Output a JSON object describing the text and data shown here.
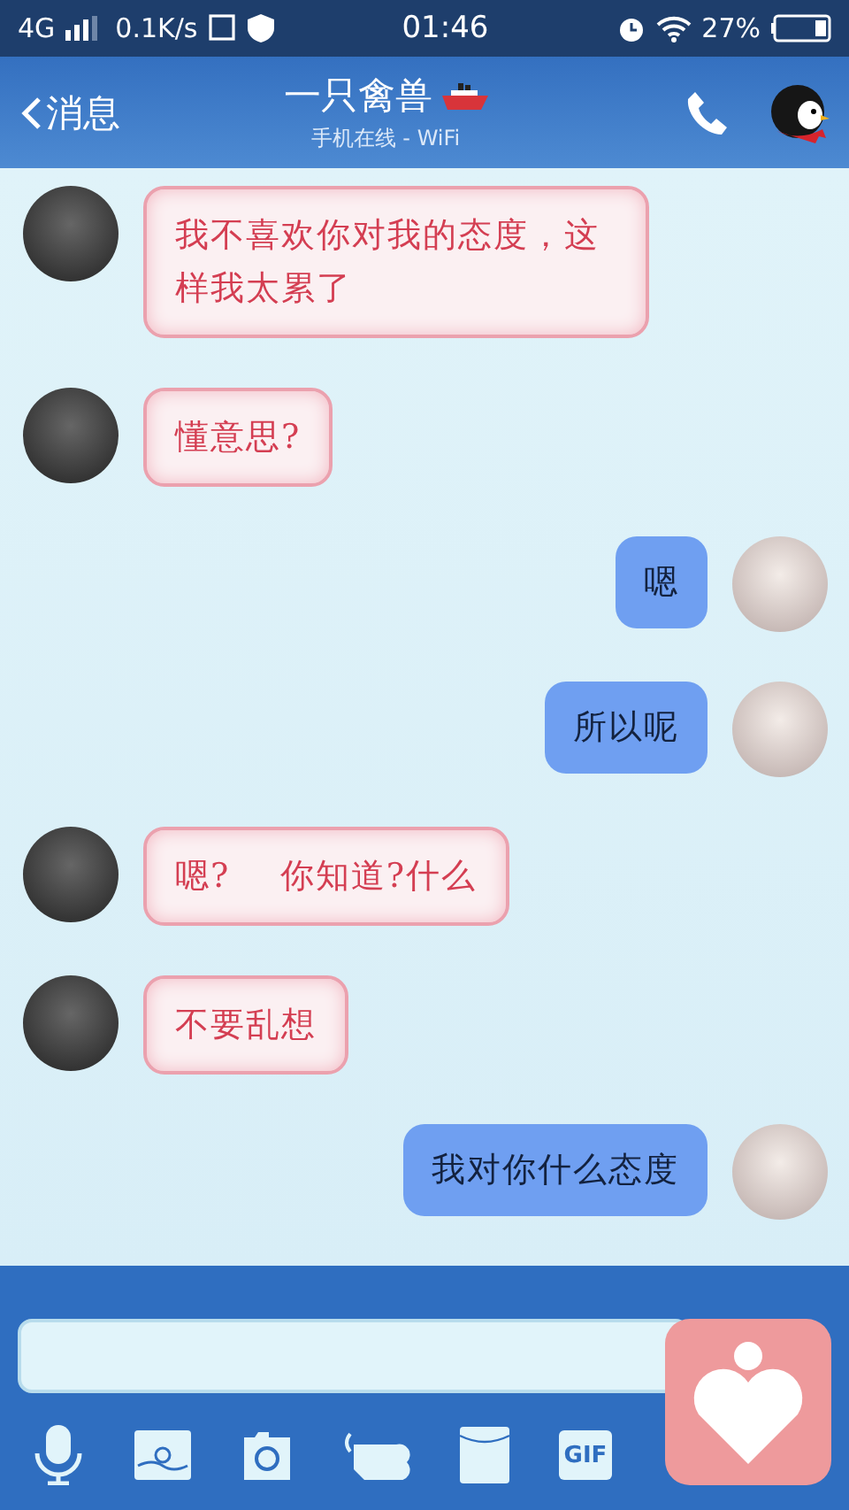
{
  "status_bar": {
    "network": "4G",
    "speed": "0.1K/s",
    "time": "01:46",
    "battery": "27%"
  },
  "header": {
    "back": "消息",
    "title": "一只禽兽",
    "subtitle": "手机在线 - WiFi"
  },
  "messages": [
    {
      "kind": "incoming",
      "text": "我不喜欢你对我的态度，这样我太累了"
    },
    {
      "kind": "incoming",
      "text": "懂意思?"
    },
    {
      "kind": "outgoing",
      "text": "嗯"
    },
    {
      "kind": "outgoing",
      "text": "所以呢"
    },
    {
      "kind": "incoming",
      "text": "嗯?    你知道?什么"
    },
    {
      "kind": "incoming",
      "text": "不要乱想"
    },
    {
      "kind": "outgoing",
      "text": "我对你什么态度"
    }
  ],
  "toolbar": {
    "gif": "GIF"
  }
}
